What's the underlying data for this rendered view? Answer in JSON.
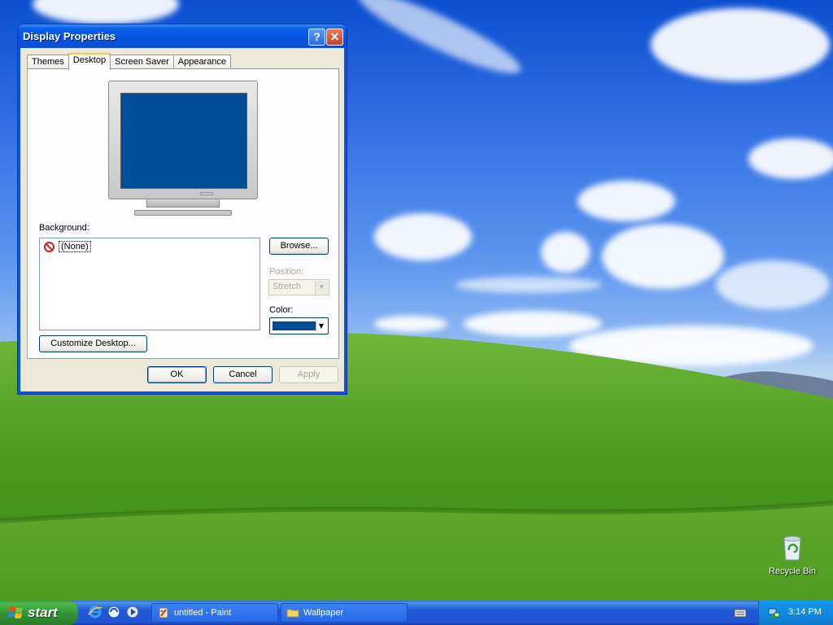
{
  "window": {
    "title": "Display Properties",
    "help_glyph": "?",
    "close_glyph": "✕",
    "tabs": [
      {
        "label": "Themes",
        "active": false
      },
      {
        "label": "Desktop",
        "active": true
      },
      {
        "label": "Screen Saver",
        "active": false
      },
      {
        "label": "Appearance",
        "active": false
      }
    ],
    "background_label": "Background:",
    "background_items": [
      {
        "label": "(None)",
        "icon": "none-icon",
        "selected": true
      }
    ],
    "browse_label": "Browse...",
    "position_label": "Position:",
    "position_value": "Stretch",
    "color_label": "Color:",
    "color_value": "#004e98",
    "customize_label": "Customize Desktop...",
    "ok_label": "OK",
    "cancel_label": "Cancel",
    "apply_label": "Apply"
  },
  "desktop": {
    "icons": [
      {
        "label": "Recycle Bin",
        "icon": "recycle-bin-icon"
      }
    ]
  },
  "taskbar": {
    "start_label": "start",
    "quick_launch": [
      "internet-explorer-icon",
      "outlook-express-icon",
      "media-player-icon"
    ],
    "tasks": [
      {
        "label": "untitled - Paint",
        "icon": "paint-icon"
      },
      {
        "label": "Wallpaper",
        "icon": "folder-icon"
      }
    ],
    "tray_icons": [
      "keyboard-icon",
      "network-icon"
    ],
    "clock": "3:14 PM"
  },
  "colors": {
    "titlebar": "#0a54e4",
    "face": "#ece9d8",
    "taskbar": "#2157d7",
    "start": "#3c9a3c",
    "desktop_color": "#004e98"
  }
}
